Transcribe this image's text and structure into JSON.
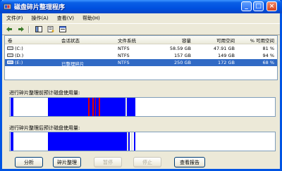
{
  "window": {
    "title": "磁盘碎片整理程序",
    "caption_buttons": [
      "_",
      "□",
      "×"
    ]
  },
  "menu": [
    "文件(F)",
    "操作(A)",
    "查看(V)",
    "帮助(H)"
  ],
  "toolbar": {
    "icons": [
      "back-arrow-icon",
      "forward-arrow-icon",
      "console-tree-icon",
      "properties-icon",
      "help-icon"
    ]
  },
  "table": {
    "headers": [
      "卷",
      "会话状态",
      "文件系统",
      "容量",
      "可用空间",
      "% 可用空间"
    ],
    "rows": [
      {
        "volume": "(C:)",
        "status": "",
        "fs": "NTFS",
        "capacity": "58.59 GB",
        "free": "47.91 GB",
        "pct": "81 %",
        "selected": false
      },
      {
        "volume": "(D:)",
        "status": "",
        "fs": "NTFS",
        "capacity": "157 GB",
        "free": "149 GB",
        "pct": "94 %",
        "selected": false
      },
      {
        "volume": "(E:)",
        "status": "已整理碎片",
        "fs": "NTFS",
        "capacity": "250 GB",
        "free": "172 GB",
        "pct": "68 %",
        "selected": true
      }
    ]
  },
  "before_label": "进行碎片整理前预计磁盘使用量:",
  "after_label": "进行碎片整理后预计磁盘使用量:",
  "colors": {
    "used": "#0000ff",
    "fragmented": "#e00000",
    "free": "#ffffff",
    "system": "#e0e0e0",
    "title_blue": "#0054e3",
    "selection": "#316ac5"
  },
  "buttons": [
    {
      "label": "分析",
      "enabled": true
    },
    {
      "label": "碎片整理",
      "enabled": true
    },
    {
      "label": "暂停",
      "enabled": false
    },
    {
      "label": "停止",
      "enabled": false
    },
    {
      "label": "查看报告",
      "enabled": true
    }
  ]
}
